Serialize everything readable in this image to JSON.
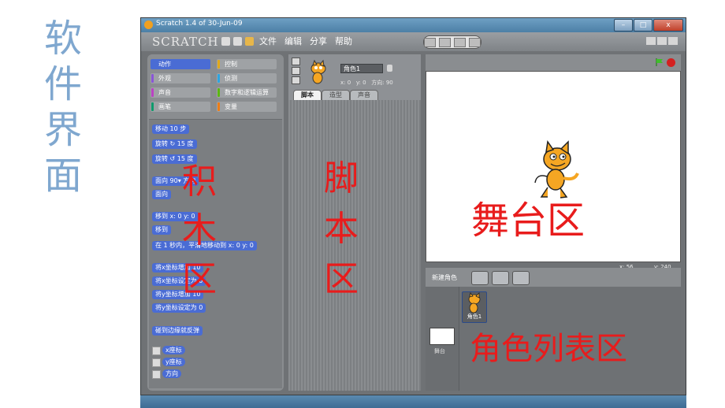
{
  "side_title": [
    "软",
    "件",
    "界",
    "面"
  ],
  "window": {
    "title": "Scratch 1.4 of 30-Jun-09",
    "buttons": [
      "–",
      "□",
      "x"
    ]
  },
  "menubar": {
    "logo": "SCRATCH",
    "items": [
      "文件",
      "编辑",
      "分享",
      "帮助"
    ]
  },
  "categories": [
    {
      "label": "动作",
      "color": "#4a6cd4",
      "active": true
    },
    {
      "label": "控制",
      "color": "#e1a91a"
    },
    {
      "label": "外观",
      "color": "#8a55d7"
    },
    {
      "label": "侦测",
      "color": "#2ca5e2"
    },
    {
      "label": "声音",
      "color": "#bb42c3"
    },
    {
      "label": "数字和逻辑运算",
      "color": "#5cb712"
    },
    {
      "label": "画笔",
      "color": "#0e9a6c"
    },
    {
      "label": "变量",
      "color": "#ee7d16"
    }
  ],
  "blocks": [
    "移动 10 步",
    "旋转 ↻ 15 度",
    "旋转 ↺ 15 度",
    "面向 90▾ 方向",
    "面向",
    "移到 x: 0 y: 0",
    "移到",
    "在 1 秒内，平滑地移动到 x: 0 y: 0",
    "将x坐标增加 10",
    "将x坐标设定为 0",
    "将y坐标增加 10",
    "将y坐标设定为 0",
    "碰到边缘就反弹"
  ],
  "reporters": [
    "x座标",
    "y座标",
    "方向"
  ],
  "sprite": {
    "name": "角色1",
    "x_label": "x: 0",
    "y_label": "y: 0",
    "dir_label": "方向: 90"
  },
  "tabs": [
    "脚本",
    "造型",
    "声音"
  ],
  "stage": {
    "mouse_x": "x: 56",
    "mouse_y": "y: 240"
  },
  "new_sprite_label": "新建角色",
  "sprite_list": {
    "stage_label": "舞台",
    "sprite_label": "角色1"
  },
  "annotations": {
    "blocks": [
      "积",
      "木",
      "区"
    ],
    "script": [
      "脚",
      "本",
      "区"
    ],
    "stage": "舞台区",
    "sprites": "角色列表区"
  },
  "colors": {
    "annotation": "#e81c1c",
    "side_title": "#7fa7cf",
    "motion": "#4a6cd4"
  }
}
